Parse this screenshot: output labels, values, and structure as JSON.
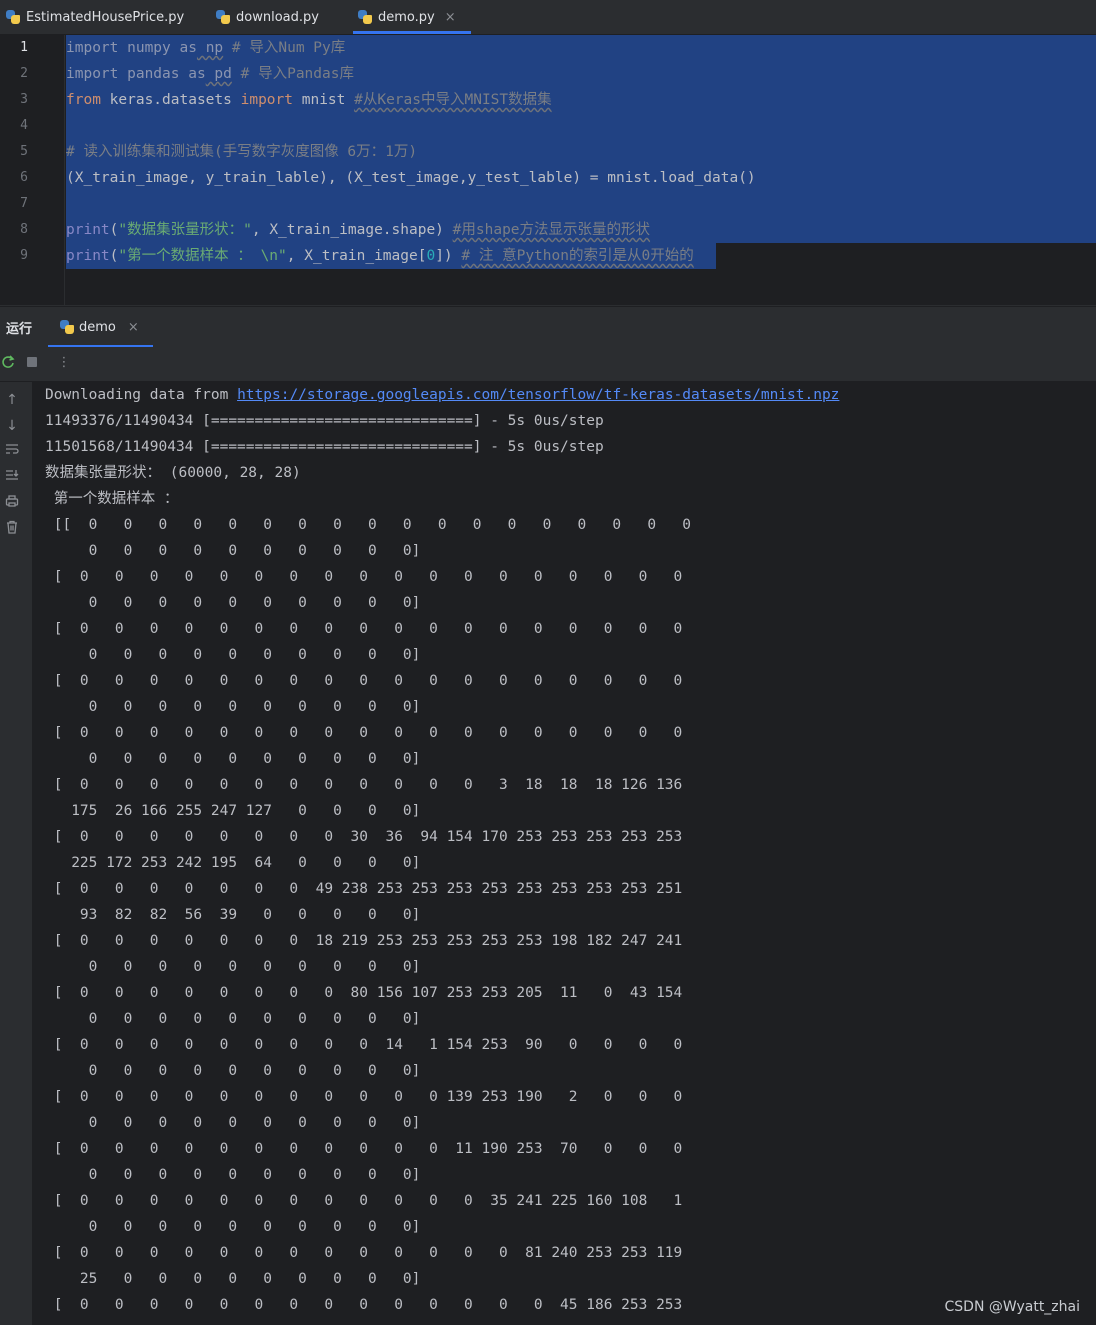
{
  "tabs": [
    {
      "label": "EstimatedHousePrice.py"
    },
    {
      "label": "download.py"
    },
    {
      "label": "demo.py",
      "close": "×"
    }
  ],
  "editor": {
    "line_numbers": [
      "1",
      "2",
      "3",
      "4",
      "5",
      "6",
      "7",
      "8",
      "9"
    ],
    "lines": {
      "l1": {
        "kw1": "import",
        "p1": " numpy ",
        "kw2": "as",
        "p2": " np",
        "cmt": " # 导入Num Py库"
      },
      "l2": {
        "kw1": "import",
        "p1": " pandas ",
        "kw2": "as",
        "p2": " pd",
        "cmt": " # 导入Pandas库"
      },
      "l3": {
        "kw1": "from",
        "p1": " keras.datasets ",
        "kw2": "import",
        "p2": " mnist ",
        "cmt": "#从Keras中导入MNIST数据集"
      },
      "l5": {
        "cmt": "# 读入训练集和测试集(手写数字灰度图像 6万：1万)"
      },
      "l6": {
        "p1": "(X_train_image, y_train_lable), (X_test_image,y_test_lable) = mnist.load_data()"
      },
      "l8": {
        "fn": "print",
        "p1": "(",
        "str": "\"数据集张量形状：\"",
        "p2": ", X_train_image.shape) ",
        "cmt": "#用shape方法显示张量的形状"
      },
      "l9": {
        "fn": "print",
        "p1": "(",
        "str": "\"第一个数据样本 ： \\n\"",
        "p2": ", X_train_image[",
        "num": "0",
        "p3": "]) ",
        "cmt": "# 注 意Python的索引是从0开始的"
      }
    }
  },
  "run": {
    "title": "运行",
    "tab_label": "demo",
    "tab_close": "×"
  },
  "console": {
    "download_prefix": "Downloading data from ",
    "download_url": "https://storage.googleapis.com/tensorflow/tf-keras-datasets/mnist.npz",
    "lines": [
      "11493376/11490434 [==============================] - 5s 0us/step",
      "11501568/11490434 [==============================] - 5s 0us/step",
      "数据集张量形状： (60000, 28, 28)",
      " 第一个数据样本 ：",
      " [[  0   0   0   0   0   0   0   0   0   0   0   0   0   0   0   0   0   0",
      "     0   0   0   0   0   0   0   0   0   0]",
      " [  0   0   0   0   0   0   0   0   0   0   0   0   0   0   0   0   0   0",
      "     0   0   0   0   0   0   0   0   0   0]",
      " [  0   0   0   0   0   0   0   0   0   0   0   0   0   0   0   0   0   0",
      "     0   0   0   0   0   0   0   0   0   0]",
      " [  0   0   0   0   0   0   0   0   0   0   0   0   0   0   0   0   0   0",
      "     0   0   0   0   0   0   0   0   0   0]",
      " [  0   0   0   0   0   0   0   0   0   0   0   0   0   0   0   0   0   0",
      "     0   0   0   0   0   0   0   0   0   0]",
      " [  0   0   0   0   0   0   0   0   0   0   0   0   3  18  18  18 126 136",
      "   175  26 166 255 247 127   0   0   0   0]",
      " [  0   0   0   0   0   0   0   0  30  36  94 154 170 253 253 253 253 253",
      "   225 172 253 242 195  64   0   0   0   0]",
      " [  0   0   0   0   0   0   0  49 238 253 253 253 253 253 253 253 253 251",
      "    93  82  82  56  39   0   0   0   0   0]",
      " [  0   0   0   0   0   0   0  18 219 253 253 253 253 253 198 182 247 241",
      "     0   0   0   0   0   0   0   0   0   0]",
      " [  0   0   0   0   0   0   0   0  80 156 107 253 253 205  11   0  43 154",
      "     0   0   0   0   0   0   0   0   0   0]",
      " [  0   0   0   0   0   0   0   0   0  14   1 154 253  90   0   0   0   0",
      "     0   0   0   0   0   0   0   0   0   0]",
      " [  0   0   0   0   0   0   0   0   0   0   0 139 253 190   2   0   0   0",
      "     0   0   0   0   0   0   0   0   0   0]",
      " [  0   0   0   0   0   0   0   0   0   0   0  11 190 253  70   0   0   0",
      "     0   0   0   0   0   0   0   0   0   0]",
      " [  0   0   0   0   0   0   0   0   0   0   0   0  35 241 225 160 108   1",
      "     0   0   0   0   0   0   0   0   0   0]",
      " [  0   0   0   0   0   0   0   0   0   0   0   0   0  81 240 253 253 119",
      "    25   0   0   0   0   0   0   0   0   0]",
      " [  0   0   0   0   0   0   0   0   0   0   0   0   0   0  45 186 253 253"
    ]
  },
  "watermark": "CSDN @Wyatt_zhai"
}
